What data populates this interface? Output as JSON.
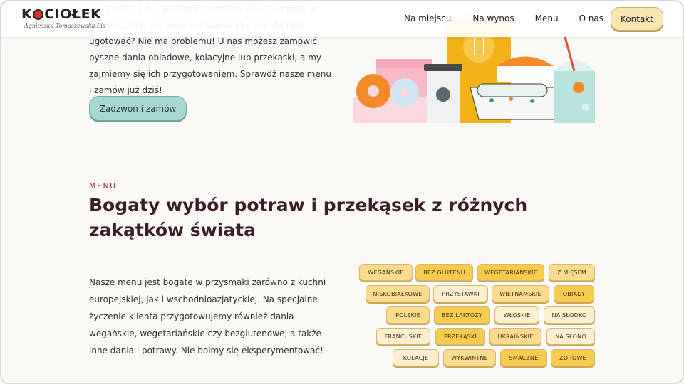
{
  "brand": {
    "name_part1": "K",
    "name_part2": "CIOŁEK",
    "tagline": "Agnieszka Tomaszewska-Lis"
  },
  "nav": {
    "links": [
      "Na miejscu",
      "Na wynos",
      "Menu",
      "O nas"
    ],
    "cta": "Kontakt"
  },
  "hero": {
    "text": "Masz ochotę na spotkanie z rodziną lub znajomymi w Twoim domu, ale nie masz czasu, aby coś dla nich ugotować? Nie ma problemu! U nas możesz zamówić pyszne dania obiadowe, kolacyjne lub przekąski, a my zajmiemy się ich przygotowaniem. Sprawdź nasze menu i zamów już dziś!",
    "button": "Zadzwoń i zamów"
  },
  "menu_section": {
    "eyebrow": "MENU",
    "headline": "Bogaty wybór potraw i przekąsek z różnych zakątków świata",
    "description": "Nasze menu jest bogate w przysmaki zarówno z kuchni europejskiej, jak i wschodnioazjatyckiej. Na specjalne życzenie klienta przygotowujemy również dania wegańskie, wegetariańskie czy bezglutenowe, a także inne dania i potrawy. Nie boimy się eksperymentować!",
    "tags": [
      {
        "label": "WEGAŃSKIE",
        "tone": "mid"
      },
      {
        "label": "BEZ GLUTENU",
        "tone": "strong"
      },
      {
        "label": "WEGETARIAŃSKIE",
        "tone": "strong"
      },
      {
        "label": "Z MIĘSEM",
        "tone": "mid"
      },
      {
        "label": "NISKOBIAŁKOWE",
        "tone": "mid"
      },
      {
        "label": "PRZYSTAWKI",
        "tone": "light"
      },
      {
        "label": "WIETNAMSKIE",
        "tone": "mid"
      },
      {
        "label": "OBIADY",
        "tone": "strong"
      },
      {
        "label": "POLSKIE",
        "tone": "mid"
      },
      {
        "label": "BEZ LAKTOZY",
        "tone": "strong"
      },
      {
        "label": "WŁOSKIE",
        "tone": "light"
      },
      {
        "label": "NA SŁODKO",
        "tone": "light"
      },
      {
        "label": "FRANCUSKIE",
        "tone": "light"
      },
      {
        "label": "PRZEKĄSKI",
        "tone": "strong"
      },
      {
        "label": "UKRAIŃSKIE",
        "tone": "mid"
      },
      {
        "label": "NA SŁONO",
        "tone": "light"
      },
      {
        "label": "KOLACJE",
        "tone": "light"
      },
      {
        "label": "WYKWINTNE",
        "tone": "mid"
      },
      {
        "label": "SMACZNE",
        "tone": "strong"
      },
      {
        "label": "ZDROWE",
        "tone": "strong"
      }
    ]
  },
  "colors": {
    "accent_eyebrow": "#8a1b2a",
    "headline": "#3a1f28",
    "cta_call": "#a8d7d2",
    "cta_contact": "#fbe6b3"
  },
  "icons": [
    "pot-logo-icon",
    "food-delivery-illustration"
  ]
}
